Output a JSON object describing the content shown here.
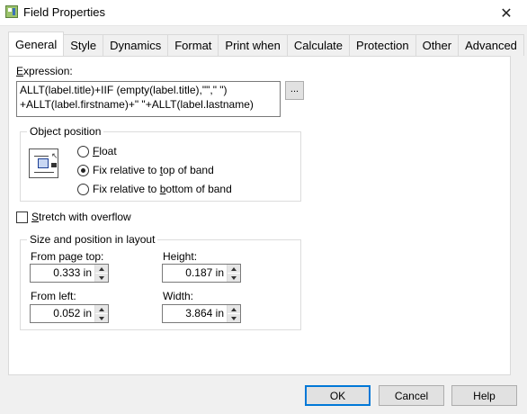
{
  "window": {
    "title": "Field Properties",
    "close_glyph": "✕"
  },
  "tabs": [
    {
      "label": "General",
      "active": true
    },
    {
      "label": "Style"
    },
    {
      "label": "Dynamics"
    },
    {
      "label": "Format"
    },
    {
      "label": "Print when"
    },
    {
      "label": "Calculate"
    },
    {
      "label": "Protection"
    },
    {
      "label": "Other"
    },
    {
      "label": "Advanced"
    }
  ],
  "expression": {
    "label_mnemonic": "E",
    "label_rest": "xpression:",
    "line1": "ALLT(label.title)+IIF (empty(label.title),\"\",\" \")",
    "line2": "+ALLT(label.firstname)+\" \"+ALLT(label.lastname)",
    "builder_button": "..."
  },
  "object_position": {
    "title": "Object position",
    "options": [
      {
        "pre": "",
        "mnemonic": "F",
        "post": "loat",
        "checked": false
      },
      {
        "pre": "Fix relative to ",
        "mnemonic": "t",
        "post": "op of band",
        "checked": true
      },
      {
        "pre": "Fix relative to ",
        "mnemonic": "b",
        "post": "ottom of band",
        "checked": false
      }
    ]
  },
  "stretch": {
    "mnemonic": "S",
    "post": "tretch with overflow",
    "checked": false
  },
  "size_position": {
    "title": "Size and position in layout",
    "from_page_top": {
      "label": "From page top:",
      "value": "0.333 in"
    },
    "height": {
      "label": "Height:",
      "value": "0.187 in"
    },
    "from_left": {
      "label": "From left:",
      "value": "0.052 in"
    },
    "width": {
      "label": "Width:",
      "value": "3.864 in"
    }
  },
  "buttons": {
    "ok": "OK",
    "cancel": "Cancel",
    "help": "Help"
  },
  "colors": {
    "accent": "#0078d7",
    "icon_box": "#c8d7f3"
  }
}
